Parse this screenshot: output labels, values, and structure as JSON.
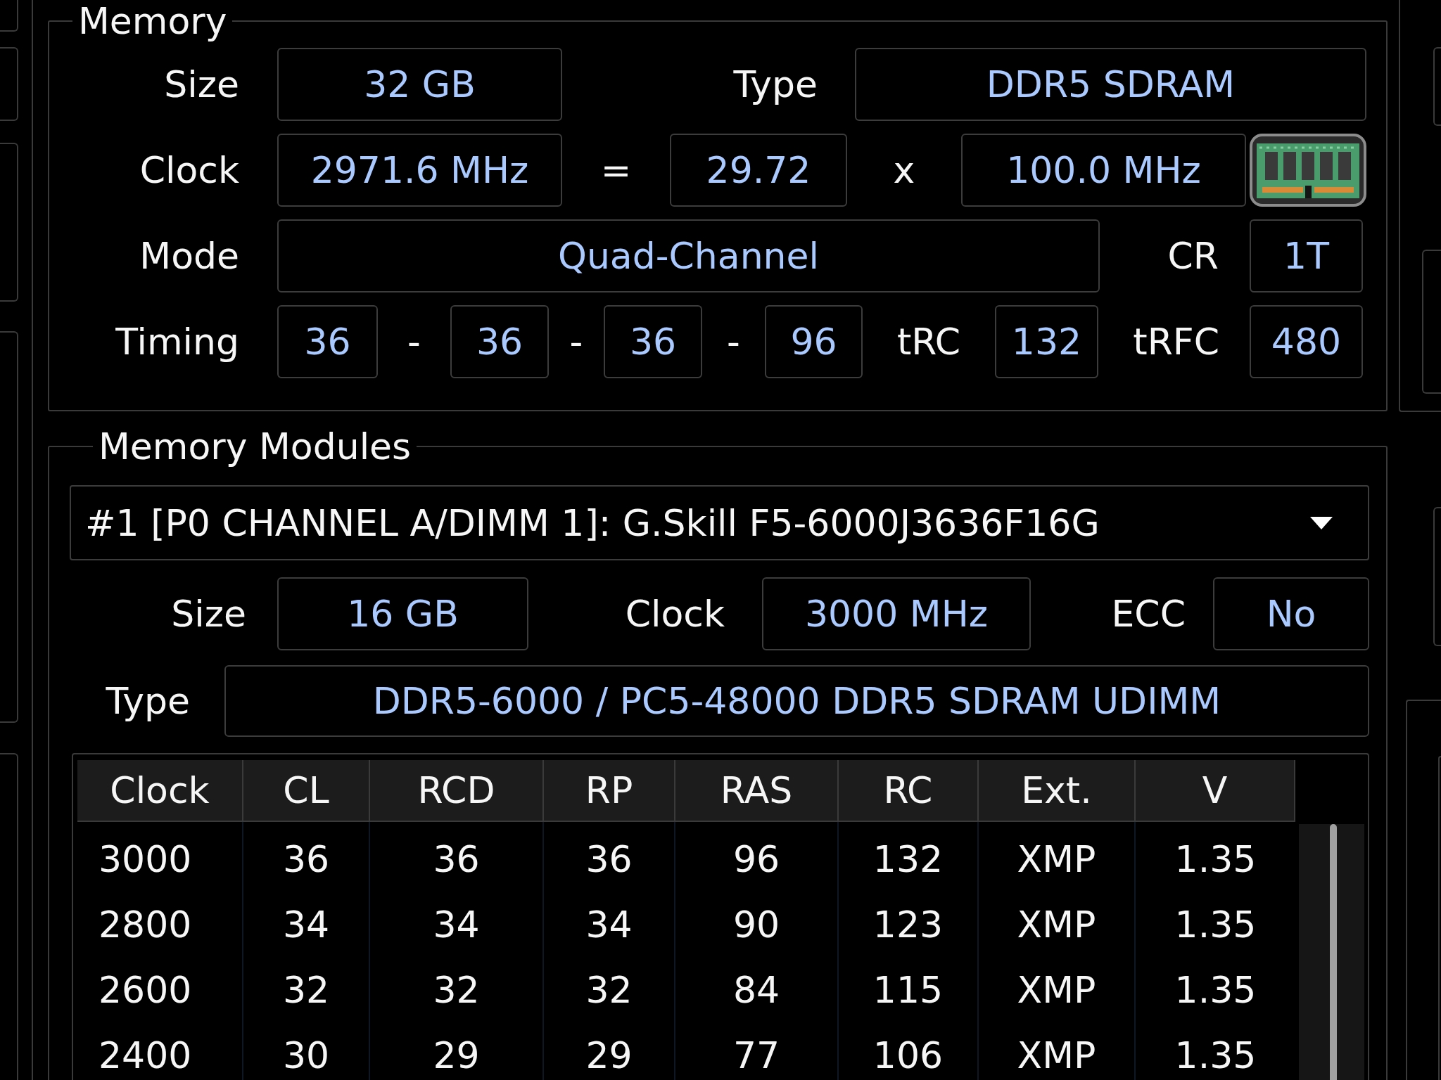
{
  "memory": {
    "title": "Memory",
    "size": {
      "label": "Size",
      "value": "32 GB"
    },
    "type": {
      "label": "Type",
      "value": "DDR5 SDRAM"
    },
    "clock": {
      "label": "Clock",
      "value": "2971.6 MHz",
      "equals": "=",
      "multiplier": "29.72",
      "times": "x",
      "base_clock": "100.0 MHz"
    },
    "mode": {
      "label": "Mode",
      "value": "Quad-Channel"
    },
    "command_rate": {
      "label": "CR",
      "value": "1T"
    },
    "timing": {
      "label": "Timing",
      "values": [
        "36",
        "36",
        "36",
        "96"
      ],
      "separators": [
        "-",
        "-",
        "-"
      ]
    },
    "trc": {
      "label": "tRC",
      "value": "132"
    },
    "trfc": {
      "label": "tRFC",
      "value": "480"
    }
  },
  "memory_modules": {
    "title": "Memory Modules",
    "module_select": {
      "value": "#1 [P0 CHANNEL A/DIMM 1]: G.Skill F5-6000J3636F16G"
    },
    "size": {
      "label": "Size",
      "value": "16 GB"
    },
    "clock": {
      "label": "Clock",
      "value": "3000 MHz"
    },
    "ecc": {
      "label": "ECC",
      "value": "No"
    },
    "type": {
      "label": "Type",
      "value": "DDR5-6000 / PC5-48000 DDR5 SDRAM UDIMM"
    },
    "table": {
      "columns": [
        "Clock",
        "CL",
        "RCD",
        "RP",
        "RAS",
        "RC",
        "Ext.",
        "V"
      ],
      "rows": [
        [
          "3000",
          "36",
          "36",
          "36",
          "96",
          "132",
          "XMP",
          "1.35"
        ],
        [
          "2800",
          "34",
          "34",
          "34",
          "90",
          "123",
          "XMP",
          "1.35"
        ],
        [
          "2600",
          "32",
          "32",
          "32",
          "84",
          "115",
          "XMP",
          "1.35"
        ],
        [
          "2400",
          "30",
          "29",
          "29",
          "77",
          "106",
          "XMP",
          "1.35"
        ]
      ]
    }
  }
}
